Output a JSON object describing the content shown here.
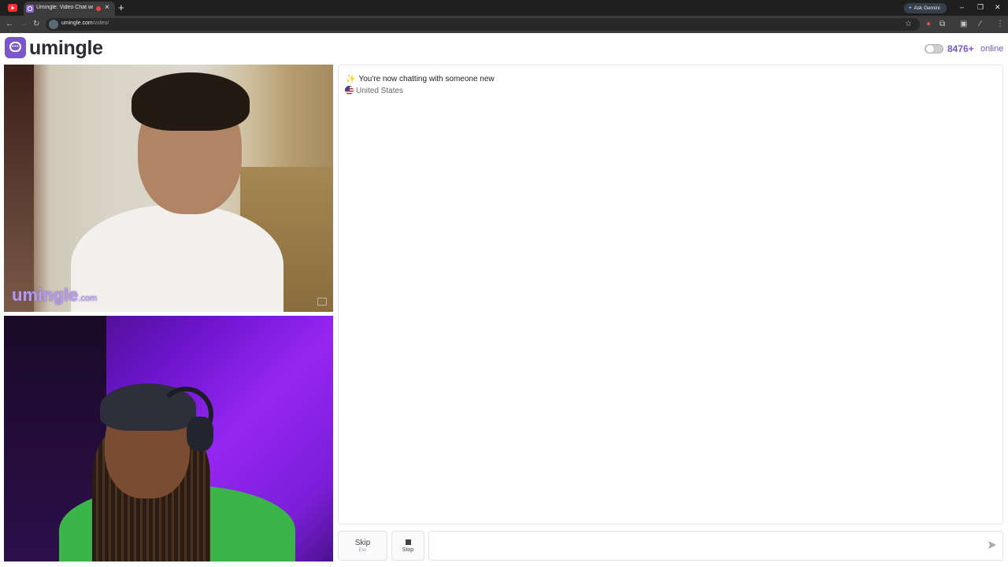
{
  "browser": {
    "tab_title": "Umingle: Video Chat with St",
    "url_domain": "umingle.com",
    "url_path": "/video/",
    "ask_gemini": "Ask Gemini"
  },
  "site": {
    "logo_text": "umingle",
    "online_count": "8476+",
    "online_label": "online",
    "brand_color": "#7a57c8"
  },
  "video": {
    "watermark_name": "umingle",
    "watermark_domain": ".com"
  },
  "chat": {
    "system_message": "You're now chatting with someone new",
    "country": "United States",
    "input_value": "",
    "input_placeholder": ""
  },
  "controls": {
    "skip_label": "Skip",
    "skip_shortcut": "Esc",
    "stop_label": "Stop"
  },
  "icons": [
    "youtube-icon",
    "umingle-favicon",
    "recording-icon",
    "close-icon",
    "plus-icon",
    "back-icon",
    "forward-icon",
    "reload-icon",
    "site-info-icon",
    "bookmark-star-icon",
    "extensions-icon",
    "sparkle-icon",
    "us-flag-icon",
    "stop-icon",
    "send-icon"
  ]
}
